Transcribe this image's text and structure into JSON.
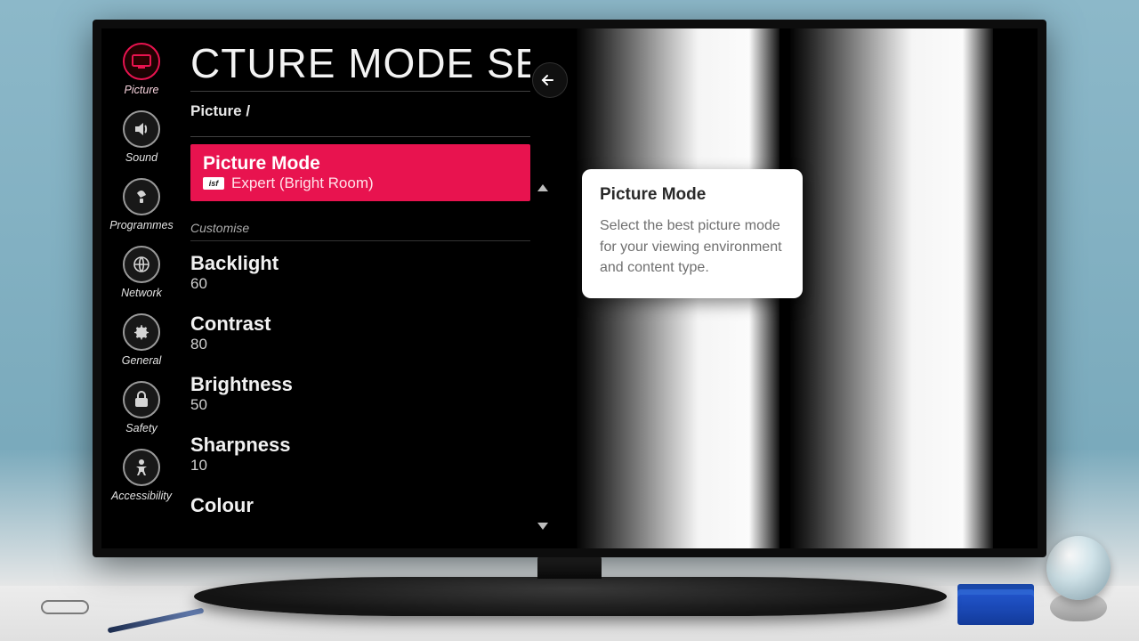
{
  "sidebar": {
    "items": [
      {
        "label": "Picture",
        "icon": "tv-icon",
        "active": true
      },
      {
        "label": "Sound",
        "icon": "speaker-icon",
        "active": false
      },
      {
        "label": "Programmes",
        "icon": "satellite-icon",
        "active": false
      },
      {
        "label": "Network",
        "icon": "globe-icon",
        "active": false
      },
      {
        "label": "General",
        "icon": "gear-icon",
        "active": false
      },
      {
        "label": "Safety",
        "icon": "lock-icon",
        "active": false
      },
      {
        "label": "Accessibility",
        "icon": "person-icon",
        "active": false
      }
    ]
  },
  "header": {
    "page_title_visible": "CTURE MODE SE",
    "breadcrumb": "Picture /"
  },
  "selected_row": {
    "title": "Picture Mode",
    "badge": "isf",
    "value": "Expert (Bright Room)"
  },
  "customise_label": "Customise",
  "settings": [
    {
      "label": "Backlight",
      "value": "60"
    },
    {
      "label": "Contrast",
      "value": "80"
    },
    {
      "label": "Brightness",
      "value": "50"
    },
    {
      "label": "Sharpness",
      "value": "10"
    },
    {
      "label": "Colour",
      "value": ""
    }
  ],
  "tooltip": {
    "title": "Picture Mode",
    "body": "Select the best picture mode for your viewing environment and content type."
  }
}
